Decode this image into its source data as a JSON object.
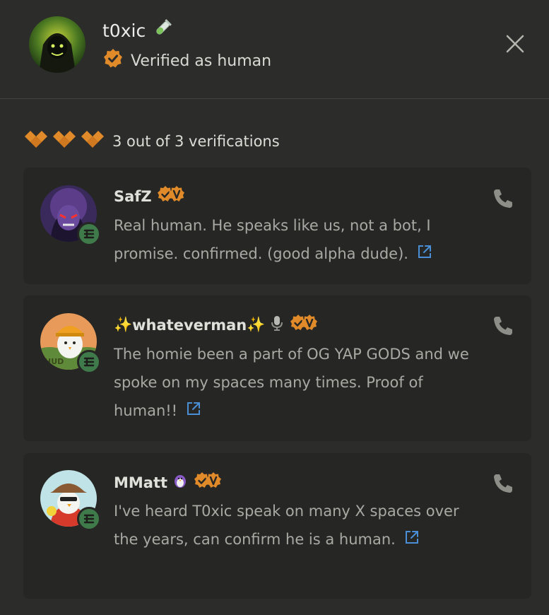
{
  "profile": {
    "name": "t0xic",
    "verified_label": "Verified as human"
  },
  "summary": {
    "text": "3 out of 3 verifications"
  },
  "verifications": [
    {
      "name": "SafZ",
      "message": "Real human. He speaks like us, not a bot, I promise. confirmed. (good alpha dude)."
    },
    {
      "name": "whateverman",
      "name_prefix": "✨",
      "name_suffix": "✨",
      "message": "The homie been a part of OG YAP GODS and we spoke on my spaces many times. Proof of human!!"
    },
    {
      "name": "MMatt",
      "message": "I've heard T0xic speak on many X spaces over the years, can confirm he is a human."
    }
  ],
  "colors": {
    "background": "#2c2c2a",
    "card": "#262624",
    "badge_orange": "#e08a2a",
    "link_blue": "#4a8fd6",
    "green_badge": "#3f7a4a"
  }
}
